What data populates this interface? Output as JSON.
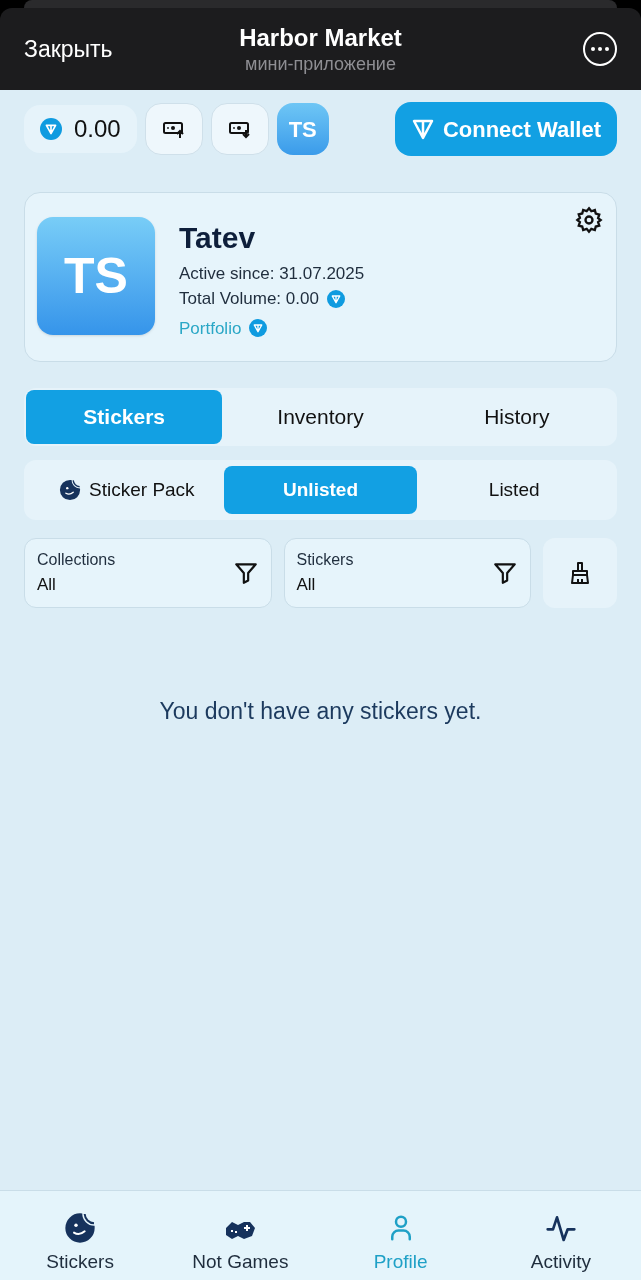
{
  "header": {
    "close": "Закрыть",
    "title": "Harbor Market",
    "subtitle": "мини-приложение"
  },
  "toolbar": {
    "balance": "0.00",
    "avatar": "TS",
    "connect": "Connect Wallet"
  },
  "profile": {
    "avatar": "TS",
    "name": "Tatev",
    "active_since": "Active since: 31.07.2025",
    "total_volume": "Total Volume: 0.00",
    "portfolio": "Portfolio"
  },
  "tabs": [
    {
      "label": "Stickers",
      "selected": true
    },
    {
      "label": "Inventory",
      "selected": false
    },
    {
      "label": "History",
      "selected": false
    }
  ],
  "subtabs": [
    {
      "label": "Sticker Pack",
      "kind": "pack",
      "selected": false
    },
    {
      "label": "Unlisted",
      "kind": "plain",
      "selected": true
    },
    {
      "label": "Listed",
      "kind": "plain",
      "selected": false
    }
  ],
  "filters": [
    {
      "label": "Collections",
      "value": "All"
    },
    {
      "label": "Stickers",
      "value": "All"
    }
  ],
  "empty_message": "You don't have any stickers yet.",
  "nav": [
    {
      "label": "Stickers",
      "selected": false
    },
    {
      "label": "Not Games",
      "selected": false
    },
    {
      "label": "Profile",
      "selected": true
    },
    {
      "label": "Activity",
      "selected": false
    }
  ]
}
